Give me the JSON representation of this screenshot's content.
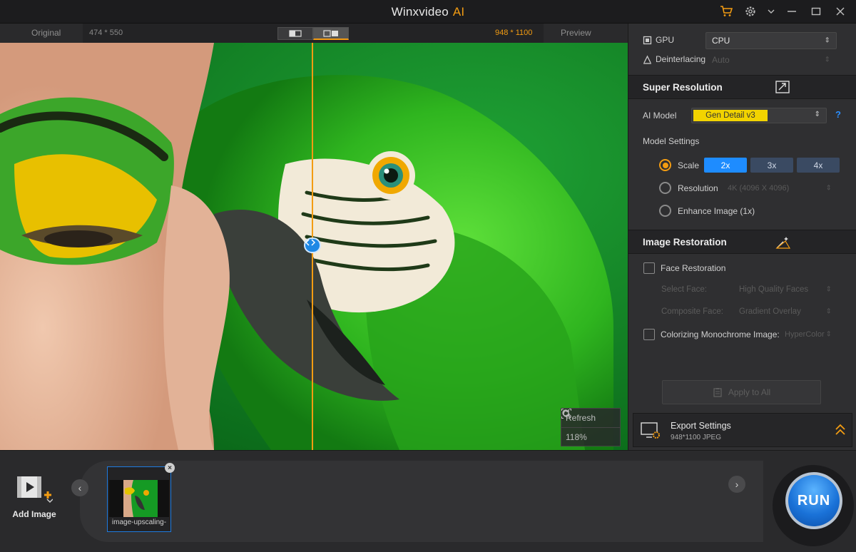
{
  "app": {
    "title": "Winxvideo",
    "title_accent": "AI"
  },
  "preview": {
    "original_label": "Original",
    "original_dim": "474 * 550",
    "preview_label": "Preview",
    "preview_dim": "948 * 1100",
    "refresh_label": "Refresh",
    "zoom": "118%"
  },
  "panel": {
    "gpu_label": "GPU",
    "gpu_value": "CPU",
    "deinterlacing_label": "Deinterlacing",
    "deinterlacing_value": "Auto",
    "super_resolution": {
      "title": "Super Resolution",
      "ai_model_label": "AI Model",
      "ai_model_value": "Gen Detail v3",
      "help": "?",
      "model_settings_label": "Model Settings",
      "scale_label": "Scale",
      "scale_options": [
        "2x",
        "3x",
        "4x"
      ],
      "scale_selected": "2x",
      "resolution_label": "Resolution",
      "resolution_value": "4K (4096 X 4096)",
      "enhance_label": "Enhance Image (1x)"
    },
    "image_restoration": {
      "title": "Image Restoration",
      "face_restoration_label": "Face Restoration",
      "select_face_label": "Select Face:",
      "select_face_value": "High Quality Faces",
      "composite_face_label": "Composite Face:",
      "composite_face_value": "Gradient Overlay",
      "colorizing_label": "Colorizing Monochrome Image:",
      "colorizing_value": "HyperColor"
    },
    "apply_label": "Apply to All",
    "export": {
      "title": "Export Settings",
      "sub": "948*1100  JPEG"
    }
  },
  "bottom": {
    "add_image_label": "Add Image",
    "thumb_name": "image-upscaling-",
    "run_label": "RUN"
  },
  "colors": {
    "accent": "#f39c12",
    "primary": "#1e8cff",
    "highlight": "#f2d300"
  }
}
